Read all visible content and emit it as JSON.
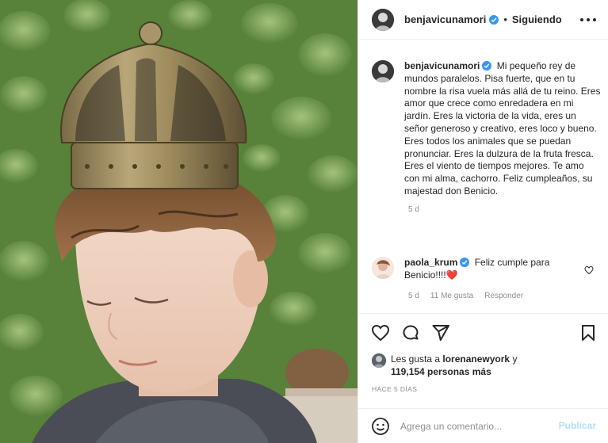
{
  "header": {
    "username": "benjavicunamori",
    "separator": "•",
    "follow_status": "Siguiendo"
  },
  "caption": {
    "username": "benjavicunamori",
    "text": "Mi pequeño rey de mundos paralelos. Pisa fuerte, que en tu nombre la risa vuela más allá de tu reino. Eres amor que crece como enredadera en mi jardín. Eres la victoria de la vida, eres un señor generoso y creativo, eres loco y bueno. Eres todos los animales que se puedan pronunciar. Eres la dulzura de la fruta fresca. Eres el viento de tiempos mejores. Te amo con mi alma, cachorro. Feliz cumpleaños, su majestad don Benicio.",
    "age": "5 d"
  },
  "comment": {
    "username": "paola_krum",
    "text": "Feliz cumple para Benicio!!!!",
    "emoji": "❤️",
    "age": "5 d",
    "likes": "11 Me gusta",
    "reply_label": "Responder"
  },
  "likes": {
    "prefix": "Les gusta a",
    "liker": "lorenanewyork",
    "connector": "y",
    "count": "119,154 personas más"
  },
  "timestamp": "HACE 5 DÍAS",
  "add_comment": {
    "placeholder": "Agrega un comentario...",
    "publish_label": "Publicar"
  },
  "colors": {
    "verified": "#3897f0",
    "heart": "#ed4956",
    "muted": "#8e8e8e",
    "publish_disabled": "#b2dffc"
  },
  "icons": [
    "verified-badge-icon",
    "more-options-icon",
    "like-heart-icon",
    "comment-icon",
    "share-icon",
    "bookmark-icon",
    "emoji-icon",
    "comment-like-icon"
  ]
}
